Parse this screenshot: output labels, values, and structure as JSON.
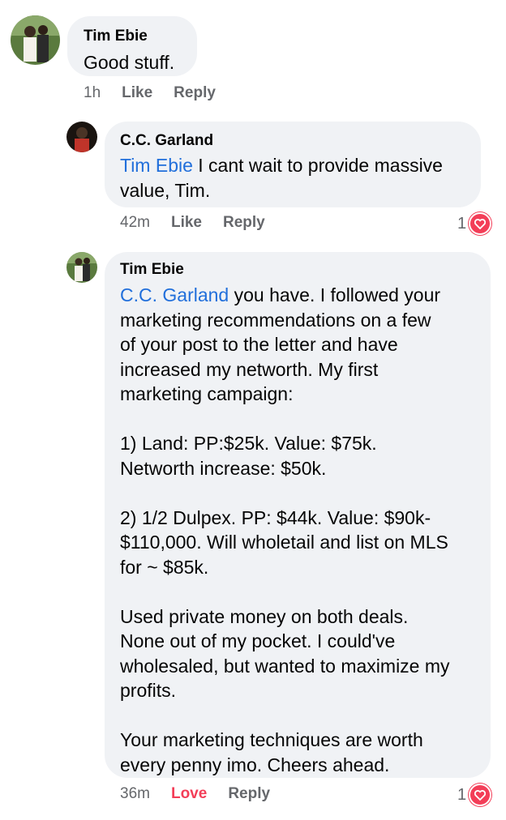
{
  "colors": {
    "bubble": "#f0f2f5",
    "mention": "#216fdb",
    "meta": "#65676b",
    "love": "#f33e58"
  },
  "comments": [
    {
      "author": "Tim Ebie",
      "text": "Good stuff.",
      "time": "1h",
      "like": "Like",
      "reply": "Reply"
    },
    {
      "author": "C.C. Garland",
      "mention": "Tim Ebie",
      "text": " I cant wait to provide massive\nvalue, Tim.",
      "time": "42m",
      "like": "Like",
      "reply": "Reply",
      "reactions": "1",
      "reaction_icon": "heart-icon"
    },
    {
      "author": "Tim Ebie",
      "mention": "C.C. Garland",
      "text": " you have. I followed your\nmarketing recommendations on a few\nof your post to the letter and have\nincreased my networth. My first\nmarketing campaign:\n\n1) Land: PP:$25k. Value: $75k.\nNetworth increase: $50k.\n\n2) 1/2 Dulpex. PP: $44k. Value: $90k-\n$110,000. Will wholetail and list on MLS\nfor ~ $85k.\n\nUsed private money on both deals.\nNone out of my pocket. I could've\nwholesaled, but wanted to maximize my\nprofits.\n\nYour marketing techniques are worth\nevery penny imo. Cheers ahead.",
      "time": "36m",
      "like": "Love",
      "reply": "Reply",
      "reactions": "1",
      "reaction_icon": "heart-icon"
    }
  ]
}
